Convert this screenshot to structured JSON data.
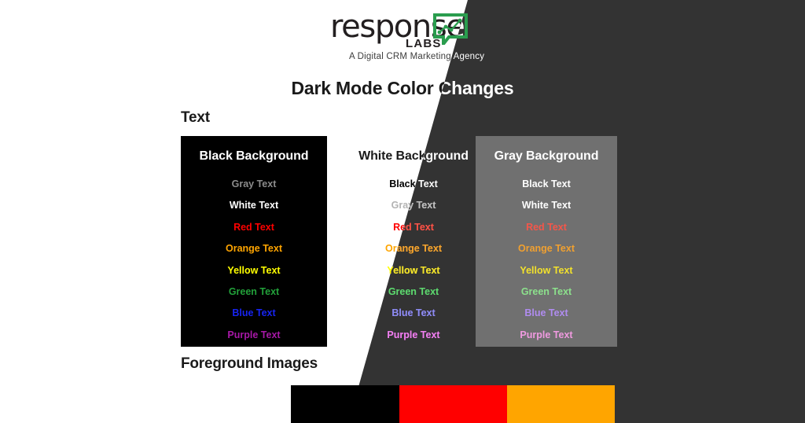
{
  "page": {
    "title": "Dark Mode Color Changes",
    "background_light": "#ffffff",
    "background_dark": "#333333"
  },
  "logo": {
    "wordmark": "response",
    "sub": "LABS",
    "tagline": "A Digital CRM Marketing Agency",
    "mark_name": "chart-speech-bubble-icon",
    "mark_color": "#2a9d4e"
  },
  "sections": {
    "text_heading": "Text",
    "foreground_heading": "Foreground Images"
  },
  "boxes": [
    {
      "id": "black",
      "title": "Black Background",
      "bg": "#000000",
      "title_color": "#ffffff",
      "rows": [
        {
          "label": "Gray Text",
          "color": "#8c8c8c"
        },
        {
          "label": "White Text",
          "color": "#ffffff"
        },
        {
          "label": "Red Text",
          "color": "#ff0000"
        },
        {
          "label": "Orange Text",
          "color": "#ffa500"
        },
        {
          "label": "Yellow Text",
          "color": "#ffff00"
        },
        {
          "label": "Green Text",
          "color": "#22a13a"
        },
        {
          "label": "Blue Text",
          "color": "#1724f2"
        },
        {
          "label": "Purple Text",
          "color": "#a718a7"
        }
      ]
    },
    {
      "id": "white",
      "title": "White Background",
      "bg": "transparent",
      "title_color": "#1a1a1a",
      "title_color_dark": "#ffffff",
      "rows": [
        {
          "label": "Black Text",
          "color": "#000000",
          "color_dark": "#ffffff"
        },
        {
          "label": "Gray Text",
          "color": "#b3b3b3",
          "color_dark": "#bdbdbd"
        },
        {
          "label": "Red Text",
          "color": "#ff0000",
          "color_dark": "#f4564a"
        },
        {
          "label": "Orange Text",
          "color": "#ffa500",
          "color_dark": "#f0a030"
        },
        {
          "label": "Yellow Text",
          "color": "#ffff00",
          "color_dark": "#f2e12c"
        },
        {
          "label": "Green Text",
          "color": "#22a13a",
          "color_dark": "#5fd46f"
        },
        {
          "label": "Blue Text",
          "color": "#7b4ce0",
          "color_dark": "#8c8cf0"
        },
        {
          "label": "Purple Text",
          "color": "#a718a7",
          "color_dark": "#ee82ee"
        }
      ]
    },
    {
      "id": "gray",
      "title": "Gray Background",
      "bg": "#707070",
      "title_color": "#ffffff",
      "rows": [
        {
          "label": "Black Text",
          "color": "#ffffff"
        },
        {
          "label": "White Text",
          "color": "#ffffff"
        },
        {
          "label": "Red Text",
          "color": "#f4564a"
        },
        {
          "label": "Orange Text",
          "color": "#f0a030"
        },
        {
          "label": "Yellow Text",
          "color": "#f2e12c"
        },
        {
          "label": "Green Text",
          "color": "#8ce08c"
        },
        {
          "label": "Blue Text",
          "color": "#b08cf0"
        },
        {
          "label": "Purple Text",
          "color": "#f09ae0"
        }
      ]
    }
  ],
  "foreground_swatches": [
    {
      "name": "black-swatch",
      "color": "#000000"
    },
    {
      "name": "red-swatch",
      "color": "#ff0000"
    },
    {
      "name": "orange-swatch",
      "color": "#ffa500"
    }
  ]
}
